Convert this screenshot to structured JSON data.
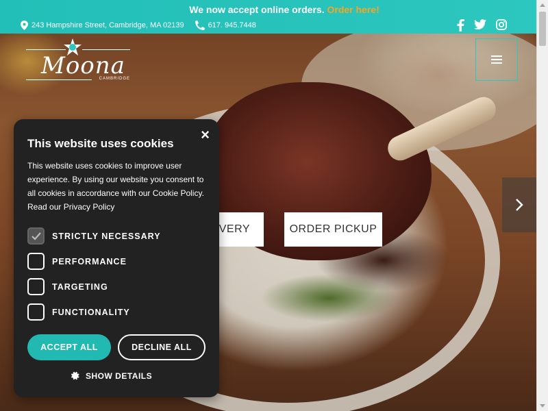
{
  "announcement": {
    "text": "We now accept online orders.",
    "link": "Order here!"
  },
  "contact": {
    "address": "243 Hampshire Street, Cambridge, MA 02139",
    "phone": "617. 945.7448"
  },
  "social": [
    "facebook-icon",
    "twitter-icon",
    "instagram-icon"
  ],
  "logo": {
    "word": "Moona",
    "sub": "CAMBRIDGE"
  },
  "hero": {
    "delivery_label": "LIVERY",
    "pickup_label": "ORDER PICKUP"
  },
  "cookie": {
    "title": "This website uses cookies",
    "body": "This website uses cookies to improve user experience. By using our website you consent to all cookies in accordance with our Cookie Policy. Read our Privacy Policy",
    "close": "×",
    "options": [
      {
        "label": "STRICTLY NECESSARY",
        "checked": true
      },
      {
        "label": "PERFORMANCE",
        "checked": false
      },
      {
        "label": "TARGETING",
        "checked": false
      },
      {
        "label": "FUNCTIONALITY",
        "checked": false
      }
    ],
    "accept_label": "ACCEPT ALL",
    "decline_label": "DECLINE ALL",
    "details_label": "SHOW DETAILS"
  },
  "colors": {
    "teal": "#22bfb8",
    "order_orange": "#f6a623",
    "modal_bg": "#222222"
  }
}
